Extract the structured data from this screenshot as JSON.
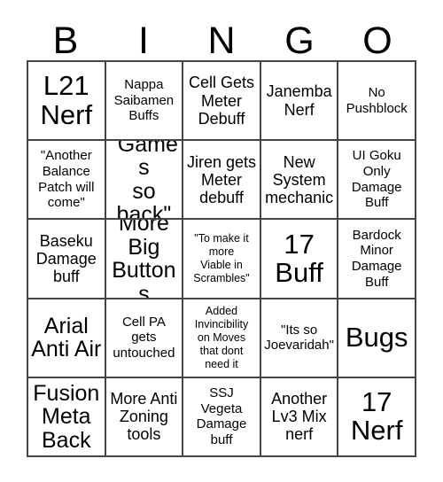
{
  "card": {
    "title_letters": [
      "B",
      "I",
      "N",
      "G",
      "O"
    ],
    "columns": 5,
    "rows": 5,
    "border_color": "#444444",
    "text_color": "#000000",
    "background_color": "#ffffff"
  },
  "cells": [
    {
      "text": "L21\nNerf",
      "size": "sz-xl"
    },
    {
      "text": "Nappa\nSaibamen\nBuffs",
      "size": "sz-sm"
    },
    {
      "text": "Cell Gets\nMeter\nDebuff",
      "size": "sz-md"
    },
    {
      "text": "Janemba\nNerf",
      "size": "sz-md"
    },
    {
      "text": "No\nPushblock",
      "size": "sz-sm"
    },
    {
      "text": "\"Another\nBalance\nPatch will\ncome\"",
      "size": "sz-sm"
    },
    {
      "text": "\"Games\nso\nback\"",
      "size": "sz-lg"
    },
    {
      "text": "Jiren gets\nMeter\ndebuff",
      "size": "sz-md"
    },
    {
      "text": "New\nSystem\nmechanic",
      "size": "sz-md"
    },
    {
      "text": "UI Goku\nOnly\nDamage\nBuff",
      "size": "sz-sm"
    },
    {
      "text": "Baseku\nDamage\nbuff",
      "size": "sz-md"
    },
    {
      "text": "More\nBig\nButtons",
      "size": "sz-lg"
    },
    {
      "text": "\"To make it\nmore\nViable in\nScrambles\"",
      "size": "sz-xs"
    },
    {
      "text": "17\nBuff",
      "size": "sz-xl"
    },
    {
      "text": "Bardock\nMinor\nDamage\nBuff",
      "size": "sz-sm"
    },
    {
      "text": "Arial\nAnti Air",
      "size": "sz-lg"
    },
    {
      "text": "Cell PA\ngets\nuntouched",
      "size": "sz-sm"
    },
    {
      "text": "Added\nInvincibility\non Moves\nthat dont\nneed it",
      "size": "sz-xs"
    },
    {
      "text": "\"Its so\nJoevaridah\"",
      "size": "sz-sm"
    },
    {
      "text": "Bugs",
      "size": "sz-xl"
    },
    {
      "text": "Fusion\nMeta\nBack",
      "size": "sz-lg"
    },
    {
      "text": "More Anti\nZoning\ntools",
      "size": "sz-md"
    },
    {
      "text": "SSJ\nVegeta\nDamage\nbuff",
      "size": "sz-sm"
    },
    {
      "text": "Another\nLv3 Mix\nnerf",
      "size": "sz-md"
    },
    {
      "text": "17\nNerf",
      "size": "sz-xl"
    }
  ]
}
